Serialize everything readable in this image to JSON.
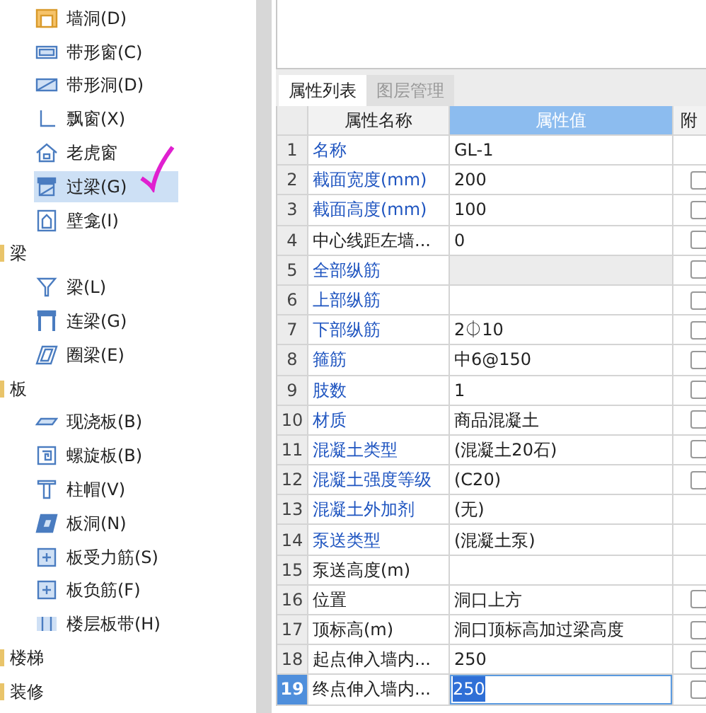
{
  "tree": [
    {
      "kind": "item",
      "label": "墙洞(D)",
      "selected": false
    },
    {
      "kind": "item",
      "label": "带形窗(C)",
      "selected": false
    },
    {
      "kind": "item",
      "label": "带形洞(D)",
      "selected": false
    },
    {
      "kind": "item",
      "label": "飘窗(X)",
      "selected": false
    },
    {
      "kind": "item",
      "label": "老虎窗",
      "selected": false
    },
    {
      "kind": "item",
      "label": "过梁(G)",
      "selected": true
    },
    {
      "kind": "item",
      "label": "壁龛(I)",
      "selected": false
    },
    {
      "kind": "group",
      "label": "梁"
    },
    {
      "kind": "item",
      "label": "梁(L)",
      "selected": false
    },
    {
      "kind": "item",
      "label": "连梁(G)",
      "selected": false
    },
    {
      "kind": "item",
      "label": "圈梁(E)",
      "selected": false
    },
    {
      "kind": "group",
      "label": "板"
    },
    {
      "kind": "item",
      "label": "现浇板(B)",
      "selected": false
    },
    {
      "kind": "item",
      "label": "螺旋板(B)",
      "selected": false
    },
    {
      "kind": "item",
      "label": "柱帽(V)",
      "selected": false
    },
    {
      "kind": "item",
      "label": "板洞(N)",
      "selected": false
    },
    {
      "kind": "item",
      "label": "板受力筋(S)",
      "selected": false
    },
    {
      "kind": "item",
      "label": "板负筋(F)",
      "selected": false
    },
    {
      "kind": "item",
      "label": "楼层板带(H)",
      "selected": false
    },
    {
      "kind": "group",
      "label": "楼梯"
    },
    {
      "kind": "group",
      "label": "装修"
    }
  ],
  "tabs": [
    {
      "label": "属性列表",
      "selected": true
    },
    {
      "label": "图层管理",
      "selected": false
    }
  ],
  "table": {
    "columns": [
      "属性名称",
      "属性值",
      "附"
    ],
    "rows": [
      {
        "num": "1",
        "name": "名称",
        "kind": "linked",
        "value": "GL-1",
        "selected": false
      },
      {
        "num": "2",
        "name": "截面宽度(mm)",
        "kind": "linked",
        "value": "200",
        "checked": false,
        "selected": false
      },
      {
        "num": "3",
        "name": "截面高度(mm)",
        "kind": "linked",
        "value": "100",
        "checked": false,
        "selected": false
      },
      {
        "num": "4",
        "name": "中心线距左墙...",
        "kind": "plain",
        "value": "0",
        "checked": false,
        "selected": false
      },
      {
        "num": "5",
        "name": "全部纵筋",
        "kind": "linked",
        "value": "",
        "disabled": true,
        "checked": false,
        "selected": false
      },
      {
        "num": "6",
        "name": "上部纵筋",
        "kind": "linked",
        "value": "",
        "checked": false,
        "selected": false
      },
      {
        "num": "7",
        "name": "下部纵筋",
        "kind": "linked",
        "value": "2⏀10",
        "checked": false,
        "selected": false
      },
      {
        "num": "8",
        "name": "箍筋",
        "kind": "linked",
        "value": "中6@150",
        "checked": false,
        "selected": false
      },
      {
        "num": "9",
        "name": "肢数",
        "kind": "linked",
        "value": "1",
        "checked": false,
        "selected": false
      },
      {
        "num": "10",
        "name": "材质",
        "kind": "linked",
        "value": "商品混凝土",
        "checked": false,
        "selected": false
      },
      {
        "num": "11",
        "name": "混凝土类型",
        "kind": "linked",
        "value": "(混凝土20石)",
        "checked": false,
        "selected": false
      },
      {
        "num": "12",
        "name": "混凝土强度等级",
        "kind": "linked",
        "value": "(C20)",
        "checked": false,
        "selected": false
      },
      {
        "num": "13",
        "name": "混凝土外加剂",
        "kind": "linked",
        "value": "(无)",
        "selected": false
      },
      {
        "num": "14",
        "name": "泵送类型",
        "kind": "linked",
        "value": "(混凝土泵)",
        "selected": false
      },
      {
        "num": "15",
        "name": "泵送高度(m)",
        "kind": "plain",
        "value": "",
        "selected": false
      },
      {
        "num": "16",
        "name": "位置",
        "kind": "plain",
        "value": "洞口上方",
        "checked": false,
        "selected": false
      },
      {
        "num": "17",
        "name": "顶标高(m)",
        "kind": "plain",
        "value": "洞口顶标高加过梁高度",
        "checked": false,
        "selected": false
      },
      {
        "num": "18",
        "name": "起点伸入墙内...",
        "kind": "plain",
        "value": "250",
        "checked": false,
        "selected": false
      },
      {
        "num": "19",
        "name": "终点伸入墙内...",
        "kind": "plain",
        "value": "250",
        "checked": false,
        "selected": true
      }
    ]
  }
}
